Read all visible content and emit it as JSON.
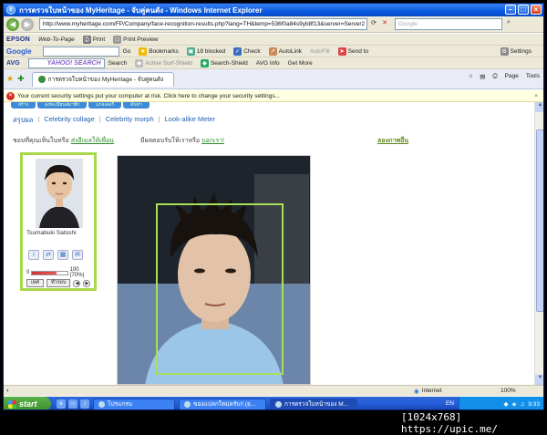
{
  "window": {
    "title": "การตรวจใบหน้าของ MyHeritage - จับคู่คนดัง - Windows Internet Explorer"
  },
  "address": {
    "url": "http://www.myheritage.com/FP/Company/face-recognition-results.php?lang=TH&temp=536f0a84s9yb8f13&server=Server2",
    "search_placeholder": "Google"
  },
  "toolbar1": {
    "brand": "EPSON",
    "web_to_page": "Web-To-Page",
    "print": "Print",
    "print_preview": "Print Preview"
  },
  "toolbar2": {
    "brand": "Google",
    "go": "Go",
    "bookmarks": "Bookmarks",
    "blocked": "18 blocked",
    "check": "Check",
    "autolink": "AutoLink",
    "autofill": "AutoFill",
    "send_to": "Send to",
    "settings": "Settings"
  },
  "toolbar3": {
    "brand": "AVG",
    "yahoo": "YAHOO! SEARCH",
    "search": "Search",
    "active_surf": "Active Surf-Shield",
    "search_shield": "Search-Shield",
    "avg_info": "AVG Info",
    "get_more": "Get More"
  },
  "tabs": {
    "active_tab": "การตรวจใบหน้าของ MyHeritage - จับคู่คนดัง",
    "page": "Page",
    "tools": "Tools"
  },
  "security_bar": {
    "message": "Your current security settings put your computer at risk. Click here to change your security settings..."
  },
  "site": {
    "top_tabs": [
      "สร้าง",
      "ลงทะเบียนสมาชิก",
      "แกลเลอรี่",
      "ค้นหา"
    ],
    "subnav": [
      "สรุปผล",
      "Celebrity collage",
      "Celebrity morph",
      "Look-alike Meter"
    ],
    "prompt_text": "ชอบที่คุณเห็นในหรือ",
    "prompt_link": "ส่งอีเมลให้เพื่อน",
    "prompt2_text": "มีผลตอบรับให้เราหรือ",
    "prompt2_link": "บอกเรา!",
    "try_link": "ลองภาพอื่น",
    "celebrity_name": "Tsumabuki Satoshi",
    "meter_min": "0",
    "meter_label": "100 (70%)",
    "match_percent": 70,
    "btn_left": "เทศ",
    "btn_right": "ทั่วรอบ"
  },
  "statusbar": {
    "zone": "Internet",
    "zoom": "100%"
  },
  "taskbar": {
    "start": "start",
    "tasks": [
      "โปรแกรม",
      "ของแปลกใหม่ครับ!! (ย...",
      "การตรวจใบหน้าของ M..."
    ],
    "lang": "EN",
    "clock": "9:33"
  },
  "watermark": "[1024x768] https://upic.me/"
}
